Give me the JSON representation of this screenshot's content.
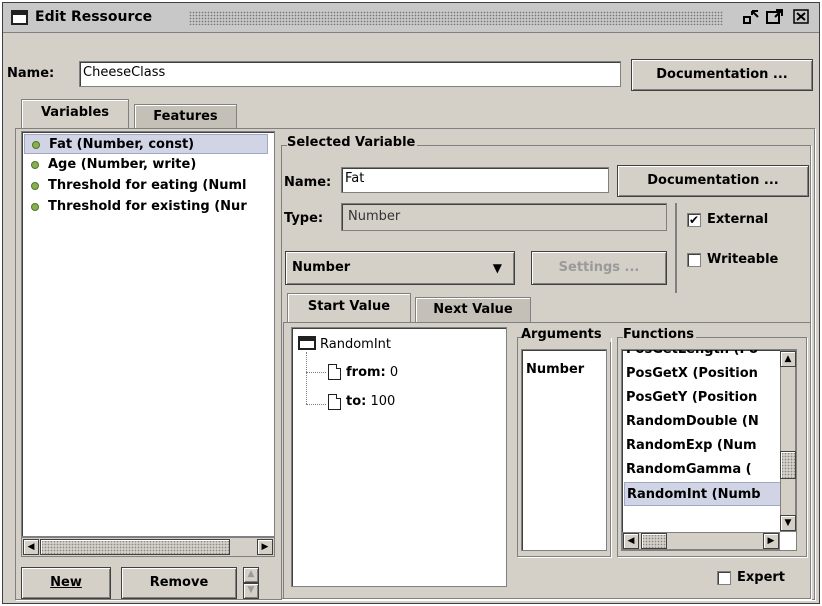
{
  "window": {
    "title": "Edit Ressource",
    "controls": [
      "minimize-icon",
      "maximize-icon",
      "close-icon"
    ]
  },
  "header": {
    "name_label": "Name:",
    "name_value": "CheeseClass",
    "documentation_label": "Documentation ..."
  },
  "tabs": [
    {
      "label": "Variables",
      "selected": true
    },
    {
      "label": "Features",
      "selected": false
    }
  ],
  "variables": {
    "items": [
      {
        "label": "Fat (Number, const)",
        "selected": true
      },
      {
        "label": "Age (Number, write)",
        "selected": false
      },
      {
        "label": "Threshold for eating (Numl",
        "selected": false
      },
      {
        "label": "Threshold for existing (Nur",
        "selected": false
      }
    ],
    "new_label": "New",
    "remove_label": "Remove",
    "status_color": "#8ab04e"
  },
  "selected_variable": {
    "group_title": "Selected Variable",
    "name_label": "Name:",
    "name_value": "Fat",
    "documentation_label": "Documentation ...",
    "type_label": "Type:",
    "type_value": "Number",
    "type_dropdown_value": "Number",
    "settings_label": "Settings ...",
    "external_label": "External",
    "external_checked": true,
    "writeable_label": "Writeable",
    "writeable_checked": false
  },
  "value_tabs": [
    {
      "label": "Start Value",
      "selected": true
    },
    {
      "label": "Next Value",
      "selected": false
    }
  ],
  "tree": {
    "root": "RandomInt",
    "children": [
      {
        "key": "from:",
        "value": "0"
      },
      {
        "key": "to:",
        "value": "100"
      }
    ]
  },
  "arguments": {
    "title": "Arguments",
    "items": [
      "Number"
    ]
  },
  "functions": {
    "title": "Functions",
    "items": [
      {
        "label": "PosGetLength (Po",
        "selected": false
      },
      {
        "label": "PosGetX (Position",
        "selected": false
      },
      {
        "label": "PosGetY (Position",
        "selected": false
      },
      {
        "label": "RandomDouble (N",
        "selected": false
      },
      {
        "label": "RandomExp (Num",
        "selected": false
      },
      {
        "label": "RandomGamma (",
        "selected": false
      },
      {
        "label": "RandomInt (Numb",
        "selected": true
      }
    ]
  },
  "expert": {
    "label": "Expert",
    "checked": false
  }
}
